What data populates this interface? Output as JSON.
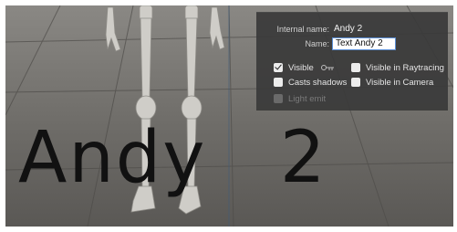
{
  "viewport": {
    "scene_text": "Andy   2"
  },
  "panel": {
    "internal_name_label": "Internal name:",
    "internal_name_value": "Andy 2",
    "name_label": "Name:",
    "name_value": "Text Andy 2",
    "checkboxes": [
      {
        "label": "Visible",
        "checked": true,
        "enabled": true
      },
      {
        "label": "Visible in Raytracing",
        "checked": false,
        "enabled": true
      },
      {
        "label": "Casts shadows",
        "checked": false,
        "enabled": true
      },
      {
        "label": "Visible in Camera",
        "checked": false,
        "enabled": true
      },
      {
        "label": "Light emit",
        "checked": false,
        "enabled": false
      }
    ],
    "link_icon": "chain-link-icon"
  },
  "colors": {
    "panel_bg": "#3a3a3a",
    "input_border": "#5b8fd6",
    "floor": "#6f6d69"
  }
}
